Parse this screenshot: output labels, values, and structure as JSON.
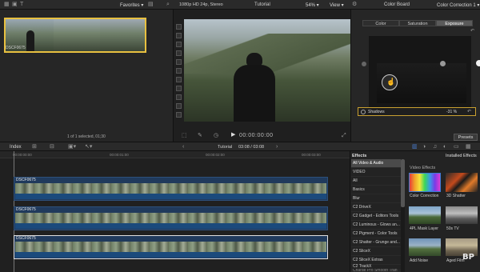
{
  "browser": {
    "favorites_label": "Favorites",
    "clip_name": "DSCF0675",
    "selection_status": "1 of 1 selected, 01;30"
  },
  "viewer": {
    "format": "1080p HD 24p, Stereo",
    "project_name": "Tutorial",
    "zoom": "54%",
    "view_label": "View",
    "timecode": "00:00:00:00"
  },
  "inspector": {
    "board_title": "Color Board",
    "correction_name": "Color Correction 1",
    "tabs": [
      "Color",
      "Saturation",
      "Exposure"
    ],
    "active_tab": "Exposure",
    "shadows_label": "Shadows",
    "shadows_value": "-31 %",
    "presets_label": "Presets"
  },
  "timeline": {
    "index_label": "Index",
    "project_name": "Tutorial",
    "duration": "03:08 / 03:08",
    "ruler": [
      "00:00:00:00",
      "00:00:01:00",
      "00:00:02:00",
      "00:00:03:00"
    ],
    "clips": [
      {
        "name": "DSCF0675"
      },
      {
        "name": "DSCF0675"
      },
      {
        "name": "DSCF0675"
      }
    ]
  },
  "effects": {
    "header": "Effects",
    "installed_label": "Installed Effects",
    "section_label": "Video Effects",
    "categories": [
      "All Video & Audio",
      "VIDEO",
      "All",
      "Basics",
      "Blur",
      "C2 DriveX",
      "C2 Gadget - Editors Tools",
      "C2 Luminous - Glows an...",
      "C2 Pigment - Color Tools",
      "C2 Shatter - Grunge and...",
      "C2 SliceX",
      "C2 SliceX Extras",
      "C2 TrackX",
      "Charge Pro Smooth Tran"
    ],
    "selected_index": 0,
    "thumbs": [
      {
        "label": "Color Correction"
      },
      {
        "label": "3D Shatter"
      },
      {
        "label": "4PL Mask Layer"
      },
      {
        "label": "50s TV"
      },
      {
        "label": "Add Noise"
      },
      {
        "label": "Aged Film"
      }
    ]
  },
  "watermark": "BP"
}
